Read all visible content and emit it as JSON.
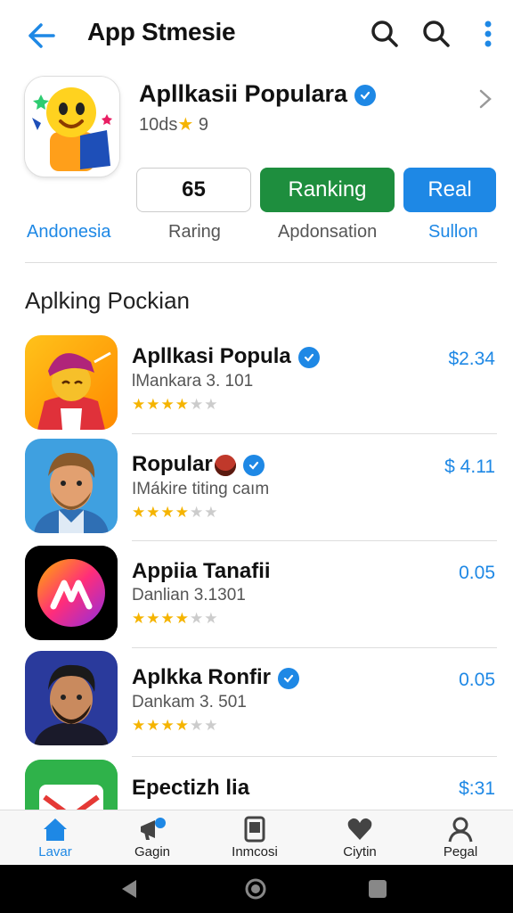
{
  "topbar": {
    "title": "App Stmesie",
    "icons": [
      "back-arrow-icon",
      "search-icon",
      "search-icon",
      "more-vert-icon"
    ]
  },
  "hero": {
    "title": "Apllkasii Populara",
    "sub_text": "10ds",
    "sub_star": "★",
    "sub_rating": "9",
    "stats": [
      {
        "value": "65",
        "label": "Raring"
      },
      {
        "value": "Ranking",
        "label": "Apdonsation"
      },
      {
        "value": "Real",
        "label": "Sullon"
      }
    ],
    "region_label": "Andonesia"
  },
  "section": {
    "title": "Aplking Pockian"
  },
  "apps": [
    {
      "name": "Apllkasi Popula",
      "sub": "lMankara 3. 101",
      "price": "$2.34",
      "rating": 4.5,
      "verified": true
    },
    {
      "name": "Ropular",
      "sub": "IMákire titing caım",
      "price": "$ 4.11",
      "rating": 4.5,
      "verified": true
    },
    {
      "name": "Appiia Tanafii",
      "sub": "Danlian 3.1301",
      "price": "0.05",
      "rating": 4.5,
      "verified": false
    },
    {
      "name": "Aplkka Ronfir",
      "sub": "Dankam 3. 501",
      "price": "0.05",
      "rating": 4.5,
      "verified": true
    },
    {
      "name": "Epectizh lia",
      "sub": "",
      "price": "$:31",
      "rating": 0,
      "verified": false
    }
  ],
  "bottom_nav": [
    {
      "label": "Lavar",
      "icon": "home-icon",
      "active": true
    },
    {
      "label": "Gagin",
      "icon": "megaphone-icon",
      "active": false
    },
    {
      "label": "Inmcosi",
      "icon": "tablet-icon",
      "active": false
    },
    {
      "label": "Ciytin",
      "icon": "heart-icon",
      "active": false
    },
    {
      "label": "Pegal",
      "icon": "person-icon",
      "active": false
    }
  ],
  "colors": {
    "accent": "#1e88e5",
    "green": "#1e8e3e",
    "star": "#f5b400"
  }
}
